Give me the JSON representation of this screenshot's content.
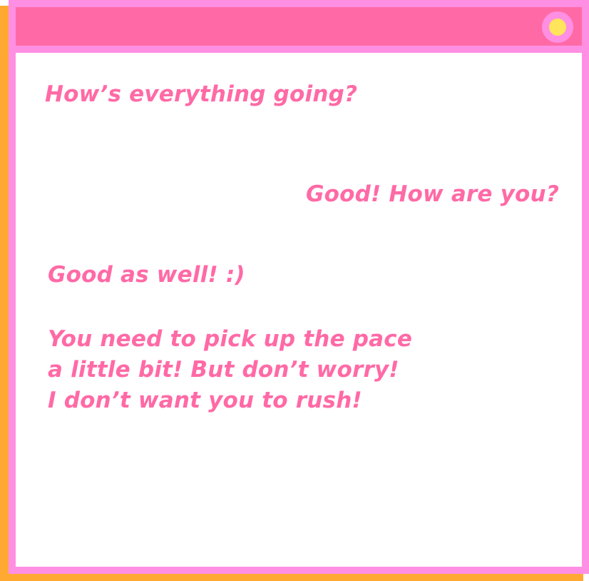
{
  "window": {
    "colors": {
      "frame": "#FF8FE3",
      "titlebar": "#FF6AA6",
      "shadow": "#FFA933",
      "dot": "#FFE45C",
      "text": "#FF6AA6",
      "content_bg": "#FFFFFF"
    },
    "titlebar_icon": "status-dot-icon"
  },
  "chat": {
    "messages": [
      {
        "text": "How’s everything going?"
      },
      {
        "text": "Good! How are you?"
      },
      {
        "text": "Good as well! :)"
      },
      {
        "lines": [
          "You need to pick up the pace",
          "a little bit! But don’t worry!",
          "I don’t want you to rush!"
        ]
      }
    ]
  }
}
